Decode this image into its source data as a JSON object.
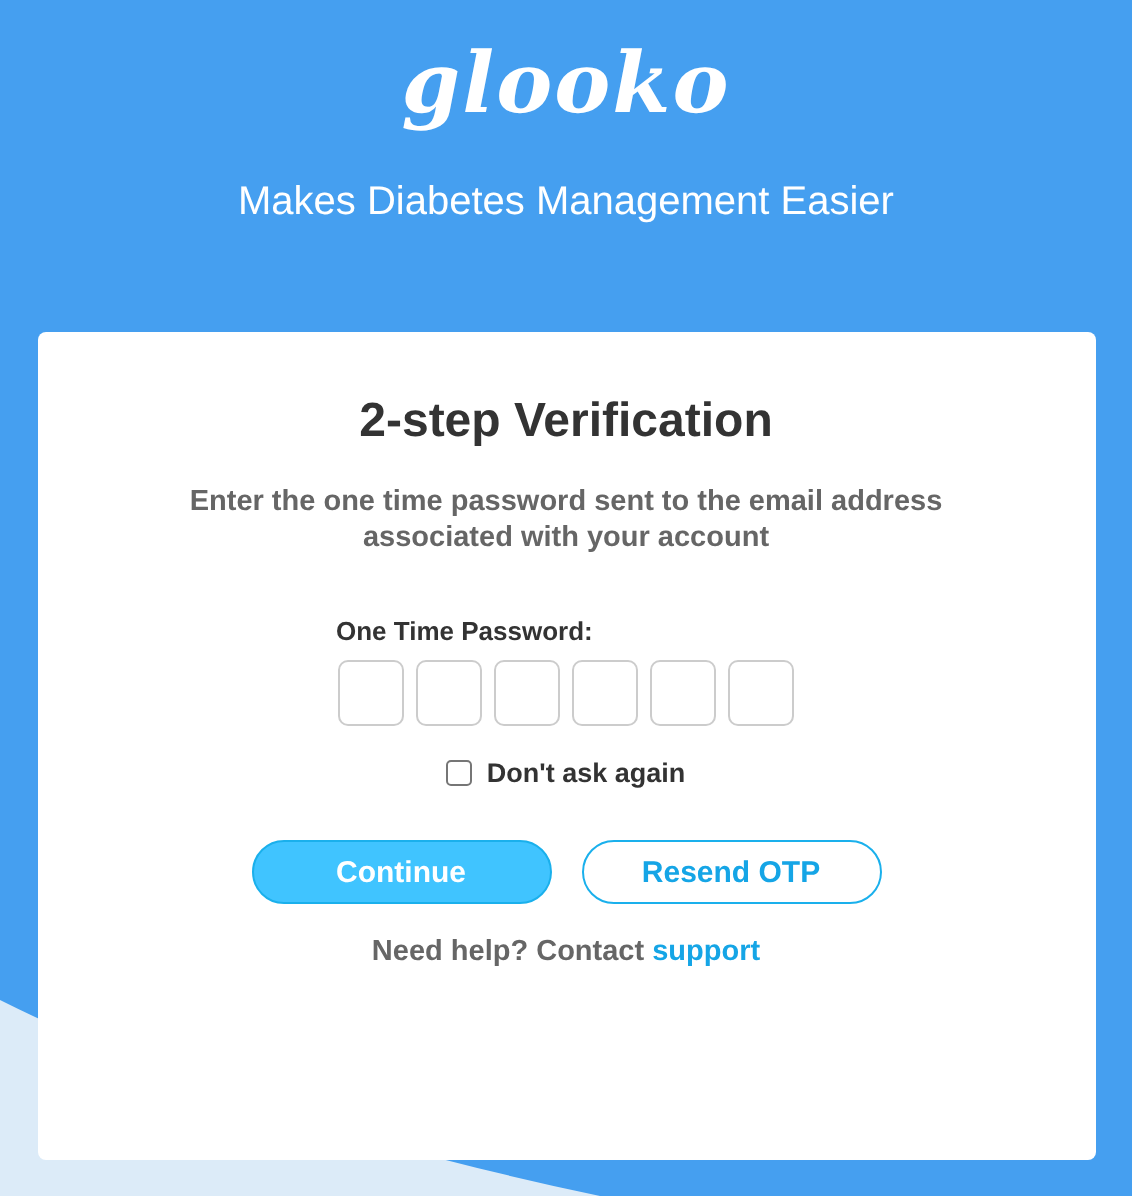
{
  "header": {
    "logo": "glooko",
    "tagline": "Makes Diabetes Management Easier"
  },
  "card": {
    "title": "2-step Verification",
    "instructions": "Enter the one time password sent to the email address associated with your account",
    "otp_label": "One Time Password:",
    "otp_fields": [
      {
        "kind": "digit"
      },
      {
        "kind": "digit"
      },
      {
        "kind": "digit"
      },
      {
        "kind": "digit"
      },
      {
        "kind": "digit"
      },
      {
        "kind": "digit"
      }
    ],
    "remember": {
      "label": "Don't ask again",
      "checked": false
    },
    "buttons": [
      {
        "label": "Continue",
        "kind": "primary"
      },
      {
        "label": "Resend OTP",
        "kind": "outline"
      }
    ],
    "help": {
      "text": "Need help? Contact",
      "link": "support"
    }
  }
}
